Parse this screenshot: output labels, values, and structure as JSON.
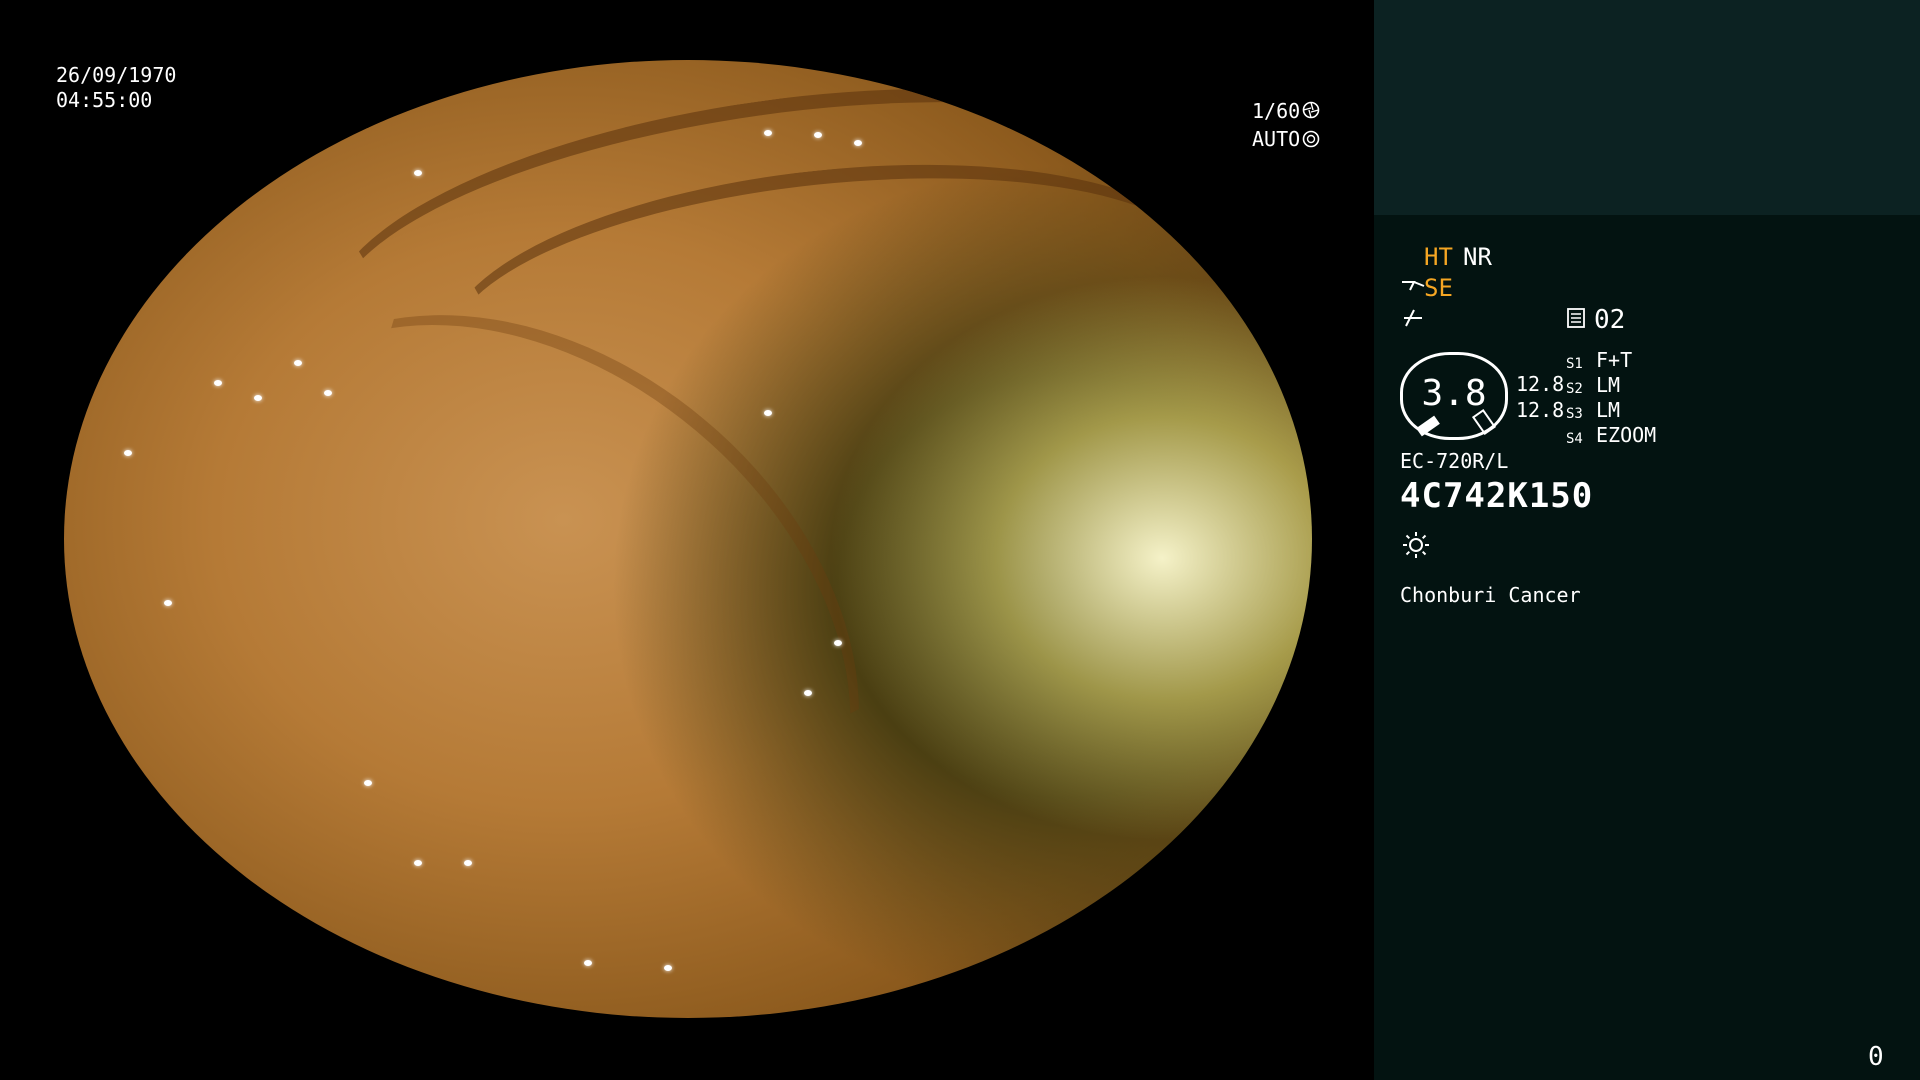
{
  "overlay": {
    "date": "26/09/1970",
    "time": "04:55:00",
    "shutter": "1/60",
    "shutter_icon": "aperture-icon",
    "iris": "AUTO",
    "iris_icon": "iris-icon"
  },
  "panel": {
    "ht": "HT",
    "nr": "NR",
    "se": "SE",
    "se_icon": "scope-tip-icon",
    "enhance_icon": "enhance-icon",
    "memory_icon": "memory-card-icon",
    "memory_number": "02",
    "gauge_value": "3.8",
    "gauge_side_1": "12.8",
    "gauge_side_2": "12.8",
    "switches": [
      {
        "key": "S1",
        "value": "F+T"
      },
      {
        "key": "S2",
        "value": "LM"
      },
      {
        "key": "S3",
        "value": "LM"
      },
      {
        "key": "S4",
        "value": "EZOOM"
      }
    ],
    "scope_model": "EC-720R/L",
    "serial": "4C742K150",
    "light_icon": "brightness-icon",
    "institution": "Chonburi Cancer",
    "counter": "0"
  },
  "colors": {
    "accent_orange": "#f5a623",
    "panel_bg": "#031311",
    "panel_top_bg": "#0c2222"
  }
}
